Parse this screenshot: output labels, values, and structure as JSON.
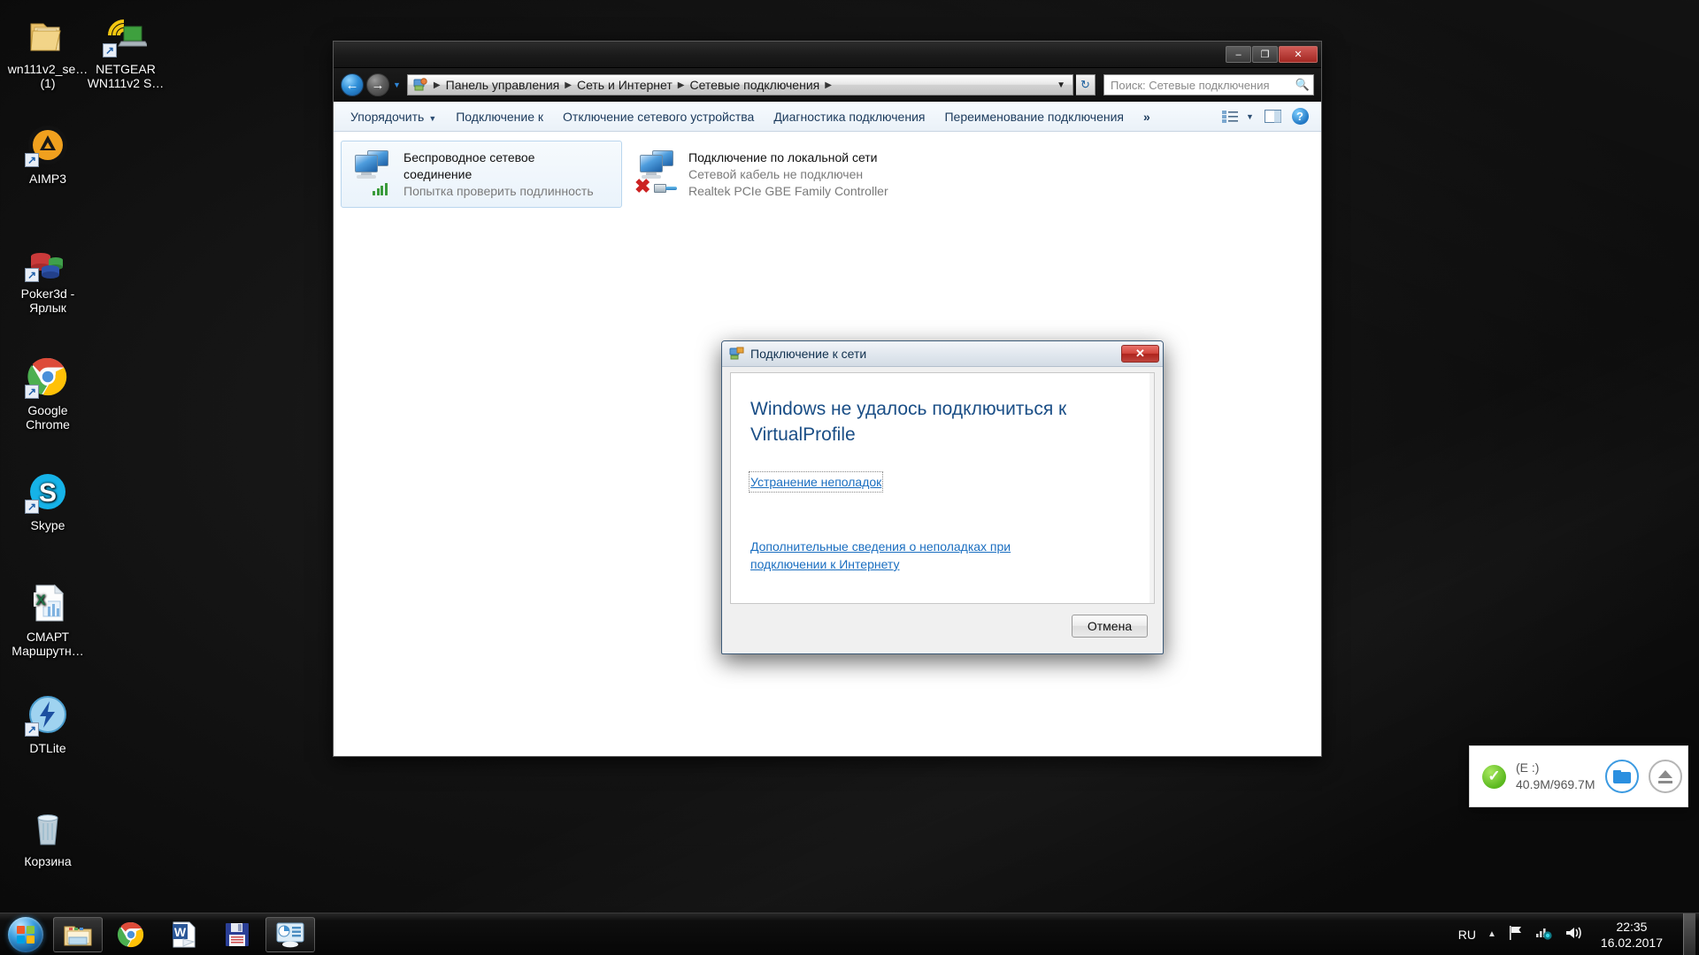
{
  "desktop": {
    "icons": [
      {
        "name": "folder-wn111v2",
        "label": "wn111v2_se… (1)",
        "icon": "folder-icon",
        "shortcut": false
      },
      {
        "name": "netgear-wn111v2",
        "label": "NETGEAR WN111v2 S…",
        "icon": "wifi-laptop-icon",
        "shortcut": true
      },
      {
        "name": "aimp3",
        "label": "AIMP3",
        "icon": "aimp-icon",
        "shortcut": true
      },
      {
        "name": "poker3d",
        "label": "Poker3d - Ярлык",
        "icon": "poker-chips-icon",
        "shortcut": true
      },
      {
        "name": "google-chrome",
        "label": "Google Chrome",
        "icon": "chrome-icon",
        "shortcut": true
      },
      {
        "name": "skype",
        "label": "Skype",
        "icon": "skype-icon",
        "shortcut": true
      },
      {
        "name": "smart-marshrut",
        "label": "СМАРТ Маршрутн…",
        "icon": "excel-file-icon",
        "shortcut": false
      },
      {
        "name": "dtlite",
        "label": "DTLite",
        "icon": "daemon-tools-icon",
        "shortcut": true
      },
      {
        "name": "recycle-bin",
        "label": "Корзина",
        "icon": "recycle-bin-icon",
        "shortcut": false
      }
    ]
  },
  "explorer": {
    "window_controls": {
      "minimize": "–",
      "maximize": "❐",
      "close": "✕"
    },
    "nav": {
      "back": "←",
      "forward": "→",
      "history_caret": "▼"
    },
    "address": {
      "crumbs": [
        "Панель управления",
        "Сеть и Интернет",
        "Сетевые подключения"
      ],
      "separator": "▶",
      "dropdown_caret": "▼",
      "refresh": "↻"
    },
    "search": {
      "placeholder": "Поиск: Сетевые подключения",
      "icon": "search-icon"
    },
    "commandbar": {
      "items": [
        {
          "label": "Упорядочить",
          "has_caret": true
        },
        {
          "label": "Подключение к",
          "has_caret": false
        },
        {
          "label": "Отключение сетевого устройства",
          "has_caret": false
        },
        {
          "label": "Диагностика подключения",
          "has_caret": false
        },
        {
          "label": "Переименование подключения",
          "has_caret": false
        }
      ],
      "overflow": "»",
      "view_caret": "▼"
    },
    "connections": [
      {
        "name": "Беспроводное сетевое соединение",
        "name_line1": "Беспроводное сетевое",
        "name_line2": "соединение",
        "status": "Попытка проверить подлинность",
        "adapter": "",
        "selected": true,
        "state": "authenticating"
      },
      {
        "name": "Подключение по локальной сети",
        "name_line1": "Подключение по локальной сети",
        "name_line2": "",
        "status": "Сетевой кабель не подключен",
        "adapter": "Realtek PCIe GBE Family Controller",
        "selected": false,
        "state": "unplugged"
      }
    ]
  },
  "dialog": {
    "title": "Подключение к сети",
    "icon": "network-connect-icon",
    "close_label": "✕",
    "heading": "Windows не удалось подключиться к VirtualProfile",
    "links": [
      {
        "label": "Устранение неполадок",
        "focused": true
      },
      {
        "label": "Дополнительные сведения о неполадках при подключении к Интернету",
        "focused": false
      }
    ],
    "buttons": [
      {
        "label": "Отмена"
      }
    ]
  },
  "tray_popup": {
    "status_icon": "check-circle-icon",
    "drive": "(E :)",
    "usage": "40.9M/969.7M",
    "open_folder_icon": "folder-icon",
    "eject_icon": "eject-icon",
    "titlebar": {
      "menu_icon": "☰",
      "minimize": "–"
    }
  },
  "taskbar": {
    "start": {
      "name": "start-orb"
    },
    "items": [
      {
        "name": "explorer",
        "icon": "folder-icon",
        "active": true
      },
      {
        "name": "chrome",
        "icon": "chrome-icon",
        "active": false
      },
      {
        "name": "word",
        "icon": "word-icon",
        "active": false
      },
      {
        "name": "save-app",
        "icon": "floppy-icon",
        "active": false
      },
      {
        "name": "network-center",
        "icon": "network-monitor-icon",
        "active": true
      }
    ],
    "tray": {
      "language": "RU",
      "caret": "▲",
      "flag_icon": "flag-icon",
      "network_icon": "network-icon",
      "volume_icon": "volume-icon",
      "time": "22:35",
      "date": "16.02.2017"
    }
  },
  "colors": {
    "accent_blue": "#1a6ec0",
    "heading_blue": "#1a4e86",
    "close_red": "#c0453e",
    "green_status": "#5ab81e",
    "taskbar_bg": "#0b0b0b"
  }
}
